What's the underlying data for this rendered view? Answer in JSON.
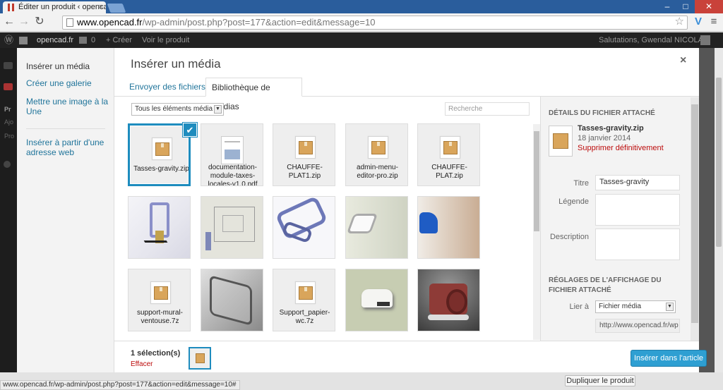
{
  "browser": {
    "tab_title": "Éditer un produit ‹ openca",
    "tab_close": "×",
    "url_host": "www.opencad.fr",
    "url_path": "/wp-admin/post.php?post=177&action=edit&message=10",
    "back": "←",
    "forward": "→",
    "reload": "↻",
    "star": "☆",
    "extension": "V",
    "menu": "≡",
    "win_min": "–",
    "win_max": "□",
    "win_close": "✕"
  },
  "adminbar": {
    "logo": "Ⓦ",
    "site": "opencad.fr",
    "comments": "0",
    "create": "+ Créer",
    "view": "Voir le produit",
    "greeting": "Salutations, Gwendal NICOLAS"
  },
  "modal": {
    "title": "Insérer un média",
    "close": "×",
    "sidebar": {
      "items": [
        {
          "label": "Insérer un média"
        },
        {
          "label": "Créer une galerie"
        },
        {
          "label": "Mettre une image à la Une"
        },
        {
          "label": "Insérer à partir d'une adresse web"
        }
      ]
    },
    "tabs": {
      "upload": "Envoyer des fichiers",
      "library": "Bibliothèque de médias"
    },
    "filter": {
      "value": "Tous les éléments média",
      "arrow": "▼"
    },
    "search": {
      "placeholder": "Recherche"
    },
    "attachments": [
      {
        "name": "Tasses-gravity.zip",
        "kind": "archive",
        "selected": true
      },
      {
        "name": "documentation-module-taxes-locales-v1.0.pdf",
        "kind": "document"
      },
      {
        "name": "CHAUFFE-PLAT1.zip",
        "kind": "archive"
      },
      {
        "name": "admin-menu-editor-pro.zip",
        "kind": "archive"
      },
      {
        "name": "CHAUFFE-PLAT.zip",
        "kind": "archive"
      },
      {
        "name": "",
        "kind": "image-render-spacer"
      },
      {
        "name": "",
        "kind": "image-drawing"
      },
      {
        "name": "",
        "kind": "image-blue-clip"
      },
      {
        "name": "",
        "kind": "image-grey-clip"
      },
      {
        "name": "",
        "kind": "image-blue-shape"
      },
      {
        "name": "support-mural-ventouse.7z",
        "kind": "archive"
      },
      {
        "name": "",
        "kind": "image-metal-bracket"
      },
      {
        "name": "Support_papier-wc.7z",
        "kind": "archive"
      },
      {
        "name": "",
        "kind": "image-white-clip"
      },
      {
        "name": "",
        "kind": "image-red-holder"
      }
    ],
    "check_mark": "✔",
    "details": {
      "heading": "Détails du fichier attaché",
      "filename": "Tasses-gravity.zip",
      "date": "18 janvier 2014",
      "delete": "Supprimer définitivement",
      "title_label": "Titre",
      "title_value": "Tasses-gravity",
      "caption_label": "Légende",
      "caption_value": "",
      "description_label": "Description",
      "description_value": "",
      "display_heading": "Réglages de l'affichage du fichier attaché",
      "link_label": "Lier à",
      "link_value": "Fichier média",
      "link_arrow": "▼",
      "link_url": "http://www.opencad.fr/wp"
    },
    "footer": {
      "selection": "1 sélection(s)",
      "clear": "Effacer",
      "insert": "Insérer dans l'article"
    }
  },
  "page": {
    "duplicate": "Dupliquer le produit",
    "status_url": "www.opencad.fr/wp-admin/post.php?post=177&action=edit&message=10#"
  },
  "colors": {
    "accent": "#1e8cbe",
    "link": "#21759b",
    "delete": "#bc0b0b",
    "primary_button": "#2e9fd2"
  }
}
